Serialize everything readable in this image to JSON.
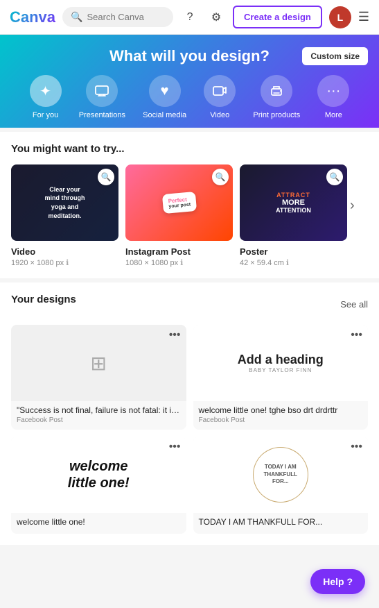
{
  "header": {
    "logo": "Canva",
    "search_placeholder": "Search Canva",
    "create_btn": "Create a design",
    "avatar_letter": "L",
    "help_icon": "?",
    "settings_icon": "⚙",
    "menu_icon": "☰"
  },
  "hero": {
    "title": "What will you design?",
    "custom_size_btn": "Custom size",
    "nav": [
      {
        "id": "for-you",
        "label": "For you",
        "icon": "✦",
        "active": true
      },
      {
        "id": "presentations",
        "label": "Presentations",
        "icon": "📋",
        "active": false
      },
      {
        "id": "social-media",
        "label": "Social media",
        "icon": "♥",
        "active": false
      },
      {
        "id": "video",
        "label": "Video",
        "icon": "▶",
        "active": false
      },
      {
        "id": "print-products",
        "label": "Print products",
        "icon": "🖨",
        "active": false
      },
      {
        "id": "more",
        "label": "More",
        "icon": "···",
        "active": false
      }
    ]
  },
  "try_section": {
    "title": "You might want to try...",
    "cards": [
      {
        "id": "video-card",
        "label": "Video",
        "sub": "1920 × 1080 px",
        "has_info": true
      },
      {
        "id": "instagram-card",
        "label": "Instagram Post",
        "sub": "1080 × 1080 px",
        "has_info": true
      },
      {
        "id": "poster-card",
        "label": "Poster",
        "sub": "42 × 59.4 cm",
        "has_info": true
      }
    ]
  },
  "designs_section": {
    "title": "Your designs",
    "see_all": "See all",
    "cards": [
      {
        "id": "design-1",
        "label": "\"Success is not final, failure is not fatal: it is t...",
        "type": "Facebook Post",
        "menu": "•••"
      },
      {
        "id": "design-2",
        "label": "welcome little one! tghe bso drt drdrttr",
        "type": "Facebook Post",
        "menu": "•••"
      },
      {
        "id": "design-3",
        "label": "welcome little one!",
        "type": "",
        "menu": "•••"
      },
      {
        "id": "design-4",
        "label": "TODAY I AM THANKFULL FOR...",
        "type": "",
        "menu": "•••"
      }
    ]
  },
  "help_btn": "Help ?"
}
